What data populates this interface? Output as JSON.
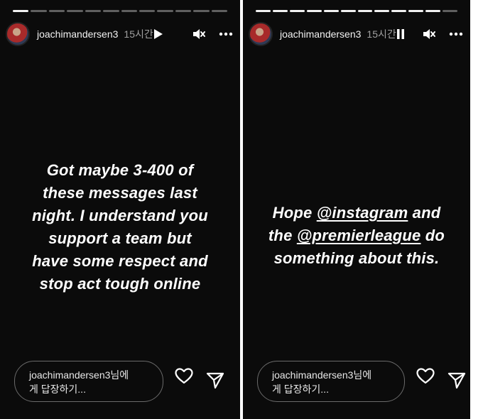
{
  "stories": [
    {
      "username": "joachimandersen3",
      "time": "15시간",
      "progress": {
        "segments": 12,
        "viewed": 1
      },
      "caption_lines": [
        "Got maybe 3-400 of",
        "these messages last",
        "night. I understand you",
        "support a team but",
        "have some respect and",
        "stop act tough online"
      ],
      "reply": {
        "line1": "joachimandersen3님에",
        "line2": "게 답장하기..."
      }
    },
    {
      "username": "joachimandersen3",
      "time": "15시간",
      "progress": {
        "segments": 12,
        "viewed": 11
      },
      "caption": {
        "l1_pre": "Hope ",
        "l1_mention": "@instagram",
        "l1_post": " and",
        "l2_pre": "the ",
        "l2_mention": "@premierleague",
        "l2_post": " do",
        "l3": "something about this."
      },
      "reply": {
        "line1": "joachimandersen3님에",
        "line2": "게 답장하기..."
      }
    }
  ],
  "colors": {
    "background": "#0b0b0b",
    "text": "#ffffff",
    "muted": "#a0a0a0"
  },
  "icons": [
    "avatar",
    "play-icon",
    "pause-icon",
    "mute-icon",
    "more-icon",
    "heart-icon",
    "send-icon"
  ]
}
